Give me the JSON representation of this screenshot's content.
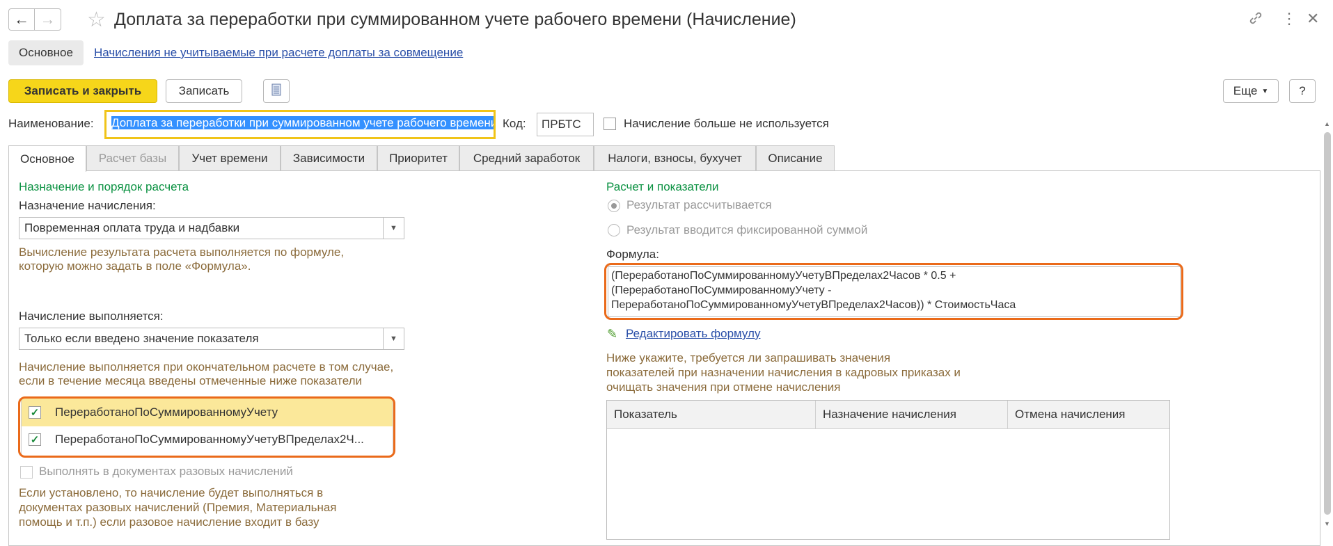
{
  "window": {
    "title": "Доплата за переработки при суммированном учете рабочего времени (Начисление)"
  },
  "sections": {
    "main": "Основное",
    "link": "Начисления не учитываемые при расчете доплаты за совмещение"
  },
  "toolbar": {
    "save_close": "Записать и закрыть",
    "save": "Записать",
    "more": "Еще",
    "help": "?"
  },
  "header": {
    "name_label": "Наименование:",
    "name_value": "Доплата за переработки при суммированном учете рабочего времени",
    "code_label": "Код:",
    "code_value": "ПРБТС",
    "unused_label": "Начисление больше не используется"
  },
  "tabs": [
    {
      "label": "Основное"
    },
    {
      "label": "Расчет базы"
    },
    {
      "label": "Учет времени"
    },
    {
      "label": "Зависимости"
    },
    {
      "label": "Приоритет"
    },
    {
      "label": "Средний заработок"
    },
    {
      "label": "Налоги, взносы, бухучет"
    },
    {
      "label": "Описание"
    }
  ],
  "left": {
    "section_title": "Назначение и порядок расчета",
    "purpose_label": "Назначение начисления:",
    "purpose_value": "Повременная оплата труда и надбавки",
    "formula_hint_1": "Вычисление результата расчета выполняется по формуле,",
    "formula_hint_2": "которую можно задать в поле «Формула».",
    "executed_label": "Начисление выполняется:",
    "executed_value": "Только если введено значение показателя",
    "executed_hint_1": "Начисление выполняется при окончательном расчете в том случае,",
    "executed_hint_2": "если в течение месяца введены отмеченные ниже показатели",
    "indicators": [
      {
        "label": "ПереработаноПоСуммированномуУчету",
        "checked": true
      },
      {
        "label": "ПереработаноПоСуммированномуУчетуВПределах2Ч...",
        "checked": true
      }
    ],
    "onetime_label": "Выполнять в документах разовых начислений",
    "onetime_hint_1": "Если установлено, то начисление будет выполняться в",
    "onetime_hint_2": "документах разовых начислений (Премия, Материальная",
    "onetime_hint_3": "помощь и т.п.) если разовое начисление входит в базу"
  },
  "right": {
    "section_title": "Расчет и показатели",
    "radio_calculated": "Результат рассчитывается",
    "radio_fixed": "Результат вводится фиксированной суммой",
    "formula_label": "Формула:",
    "formula_line1": "(ПереработаноПоСуммированномуУчетуВПределах2Часов * 0.5 +",
    "formula_line2": "(ПереработаноПоСуммированномуУчету -",
    "formula_line3": "ПереработаноПоСуммированномуУчетуВПределах2Часов)) * СтоимостьЧаса",
    "edit_formula": "Редактировать формулу",
    "table_hint_1": "Ниже укажите, требуется ли запрашивать значения",
    "table_hint_2": "показателей при назначении начисления в кадровых приказах и",
    "table_hint_3": "очищать значения при отмене начисления",
    "columns": [
      "Показатель",
      "Назначение начисления",
      "Отмена начисления"
    ]
  },
  "colors": {
    "accent_yellow": "#f6d61a",
    "highlight_orange": "#ea6a1a",
    "section_green": "#0a9141",
    "hint_brown": "#8b6b3b",
    "link_blue": "#2a4fa8"
  }
}
